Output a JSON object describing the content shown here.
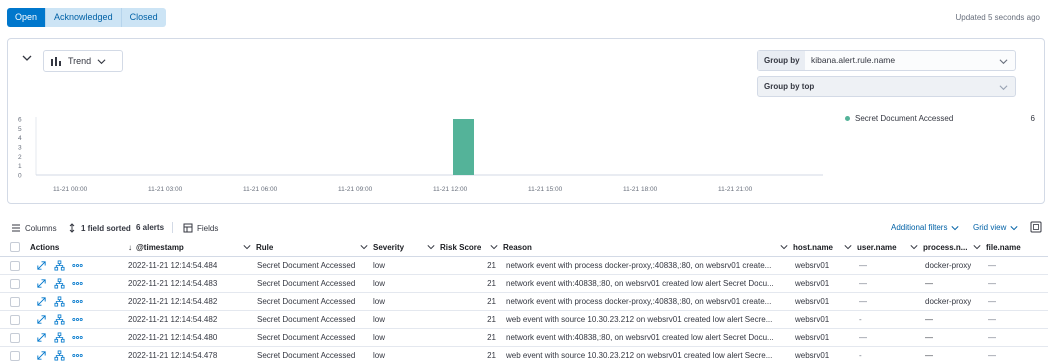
{
  "status_tabs": [
    "Open",
    "Acknowledged",
    "Closed"
  ],
  "updated_text": "Updated 5 seconds ago",
  "histogram": {
    "view_label": "Trend",
    "group_by_label": "Group by",
    "group_by_value": "kibana.alert.rule.name",
    "group_by_top_label": "Group by top",
    "legend": [
      {
        "name": "Secret Document Accessed",
        "count": "6"
      }
    ]
  },
  "chart_data": {
    "type": "bar",
    "x_ticks": [
      "11-21 00:00",
      "11-21 03:00",
      "11-21 06:00",
      "11-21 09:00",
      "11-21 12:00",
      "11-21 15:00",
      "11-21 18:00",
      "11-21 21:00"
    ],
    "y_ticks": [
      "0",
      "1",
      "2",
      "3",
      "4",
      "5",
      "6"
    ],
    "ylim": [
      0,
      6
    ],
    "bars": [
      {
        "x": "11-21 12:00",
        "value": 6,
        "series": "Secret Document Accessed"
      }
    ],
    "color": "#54b399",
    "legend_position": "right"
  },
  "toolbar": {
    "columns_label": "Columns",
    "sort_label": "1 field sorted",
    "alerts_count": "6 alerts",
    "fields_label": "Fields",
    "additional_filters_label": "Additional filters",
    "grid_view_label": "Grid view"
  },
  "table": {
    "headers": {
      "actions": "Actions",
      "timestamp": "@timestamp",
      "rule": "Rule",
      "severity": "Severity",
      "risk": "Risk Score",
      "reason": "Reason",
      "host": "host.name",
      "user": "user.name",
      "process": "process.n...",
      "file": "file.name"
    },
    "rows": [
      {
        "timestamp": "2022-11-21 12:14:54.484",
        "rule": "Secret Document Accessed",
        "severity": "low",
        "risk": "21",
        "reason": "network event with process docker-proxy,:40838,:80, on websrv01 create...",
        "host": "websrv01",
        "user": "—",
        "process": "docker-proxy",
        "file": "—"
      },
      {
        "timestamp": "2022-11-21 12:14:54.483",
        "rule": "Secret Document Accessed",
        "severity": "low",
        "risk": "21",
        "reason": "network event with:40838,:80, on websrv01 created low alert Secret Docu...",
        "host": "websrv01",
        "user": "—",
        "process": "—",
        "file": "—"
      },
      {
        "timestamp": "2022-11-21 12:14:54.482",
        "rule": "Secret Document Accessed",
        "severity": "low",
        "risk": "21",
        "reason": "network event with process docker-proxy,:40838,:80, on websrv01 create...",
        "host": "websrv01",
        "user": "—",
        "process": "docker-proxy",
        "file": "—"
      },
      {
        "timestamp": "2022-11-21 12:14:54.482",
        "rule": "Secret Document Accessed",
        "severity": "low",
        "risk": "21",
        "reason": "web event with source 10.30.23.212 on websrv01 created low alert Secre...",
        "host": "websrv01",
        "user": "-",
        "process": "—",
        "file": "—"
      },
      {
        "timestamp": "2022-11-21 12:14:54.480",
        "rule": "Secret Document Accessed",
        "severity": "low",
        "risk": "21",
        "reason": "network event with:40838,:80, on websrv01 created low alert Secret Docu...",
        "host": "websrv01",
        "user": "—",
        "process": "—",
        "file": "—"
      },
      {
        "timestamp": "2022-11-21 12:14:54.478",
        "rule": "Secret Document Accessed",
        "severity": "low",
        "risk": "21",
        "reason": "web event with source 10.30.23.212 on websrv01 created low alert Secre...",
        "host": "websrv01",
        "user": "-",
        "process": "—",
        "file": "—"
      }
    ]
  }
}
